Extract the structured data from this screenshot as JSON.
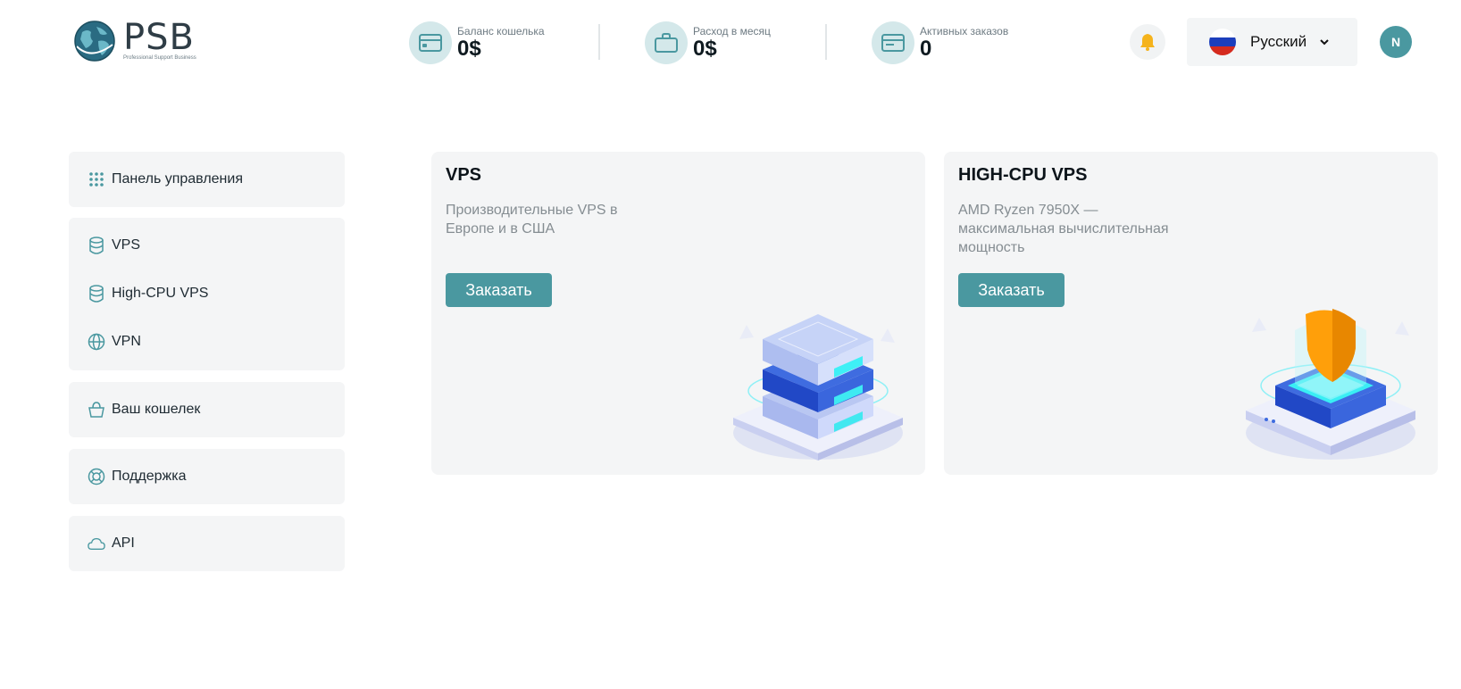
{
  "header": {
    "logo": {
      "word": "PSB",
      "tagline": "Professional Support Business"
    },
    "stats": [
      {
        "label": "Баланс кошелька",
        "value": "0$",
        "icon": "credit-card-icon"
      },
      {
        "label": "Расход в месяц",
        "value": "0$",
        "icon": "briefcase-icon"
      },
      {
        "label": "Активных заказов",
        "value": "0",
        "icon": "card-list-icon"
      }
    ],
    "notifications_icon": "bell-icon",
    "language": {
      "selected": "Русский",
      "flag": "russia-flag-icon"
    },
    "avatar_initial": "N"
  },
  "sidebar": {
    "dashboard": {
      "label": "Панель управления",
      "icon": "grid-dots-icon"
    },
    "services": [
      {
        "label": "VPS",
        "icon": "database-icon"
      },
      {
        "label": "High-CPU VPS",
        "icon": "database-icon"
      },
      {
        "label": "VPN",
        "icon": "globe-icon"
      }
    ],
    "wallet": {
      "label": "Ваш кошелек",
      "icon": "basket-icon"
    },
    "support": {
      "label": "Поддержка",
      "icon": "lifebuoy-icon"
    },
    "api": {
      "label": "API",
      "icon": "cloud-icon"
    }
  },
  "cards": [
    {
      "title": "VPS",
      "description": "Производительные VPS в Европе и в США",
      "button": "Заказать",
      "art": "server-stack-illustration"
    },
    {
      "title": "HIGH-CPU VPS",
      "description": "AMD Ryzen 7950X — максимальная вычислительная мощность",
      "button": "Заказать",
      "art": "shield-platform-illustration"
    }
  ],
  "colors": {
    "accent": "#4a98a0",
    "accent_light": "#d4e8ea",
    "panel_bg": "#f4f5f6",
    "bell": "#f5b31c"
  }
}
